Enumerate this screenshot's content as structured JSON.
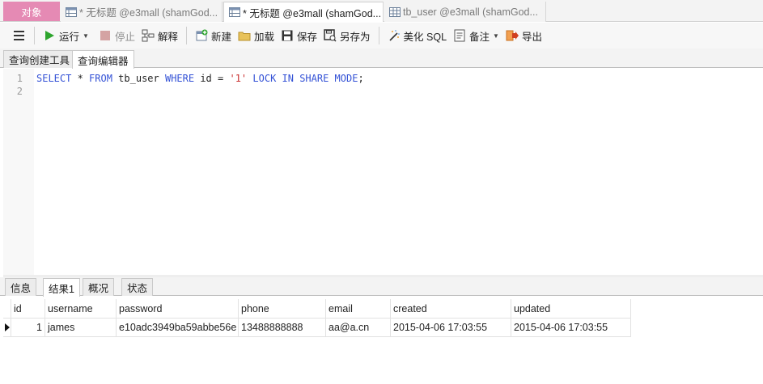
{
  "tabs": [
    {
      "label": "对象",
      "icon": "none"
    },
    {
      "label": "* 无标题 @e3mall (shamGod...",
      "icon": "query-icon"
    },
    {
      "label": "* 无标题 @e3mall (shamGod...",
      "icon": "query-icon"
    },
    {
      "label": "tb_user @e3mall (shamGod...",
      "icon": "table-icon"
    }
  ],
  "toolbar": {
    "run": "运行",
    "stop": "停止",
    "explain": "解释",
    "new": "新建",
    "load": "加载",
    "save": "保存",
    "save_as": "另存为",
    "beautify": "美化 SQL",
    "note": "备注",
    "export": "导出"
  },
  "editor_tabs": [
    "查询创建工具",
    "查询编辑器"
  ],
  "editor": {
    "line_numbers": [
      "1",
      "2"
    ],
    "sql_tokens": {
      "select": "SELECT",
      "star": " * ",
      "from": "FROM",
      "table": " tb_user ",
      "where": "WHERE",
      "cond": " id = ",
      "value": "'1'",
      "sp": " ",
      "lock_in_share_mode": "LOCK IN SHARE MODE",
      "semi": ";"
    }
  },
  "result_tabs": [
    "信息",
    "结果1",
    "概况",
    "状态"
  ],
  "grid": {
    "columns": [
      "id",
      "username",
      "password",
      "phone",
      "email",
      "created",
      "updated"
    ],
    "rows": [
      [
        "1",
        "james",
        "e10adc3949ba59abbe56e",
        "13488888888",
        "aa@a.cn",
        "2015-04-06 17:03:55",
        "2015-04-06 17:03:55"
      ]
    ]
  },
  "colors": {
    "objects_tab": "#e58ab4",
    "sql_keyword": "#3452d6",
    "sql_string": "#c93030"
  }
}
